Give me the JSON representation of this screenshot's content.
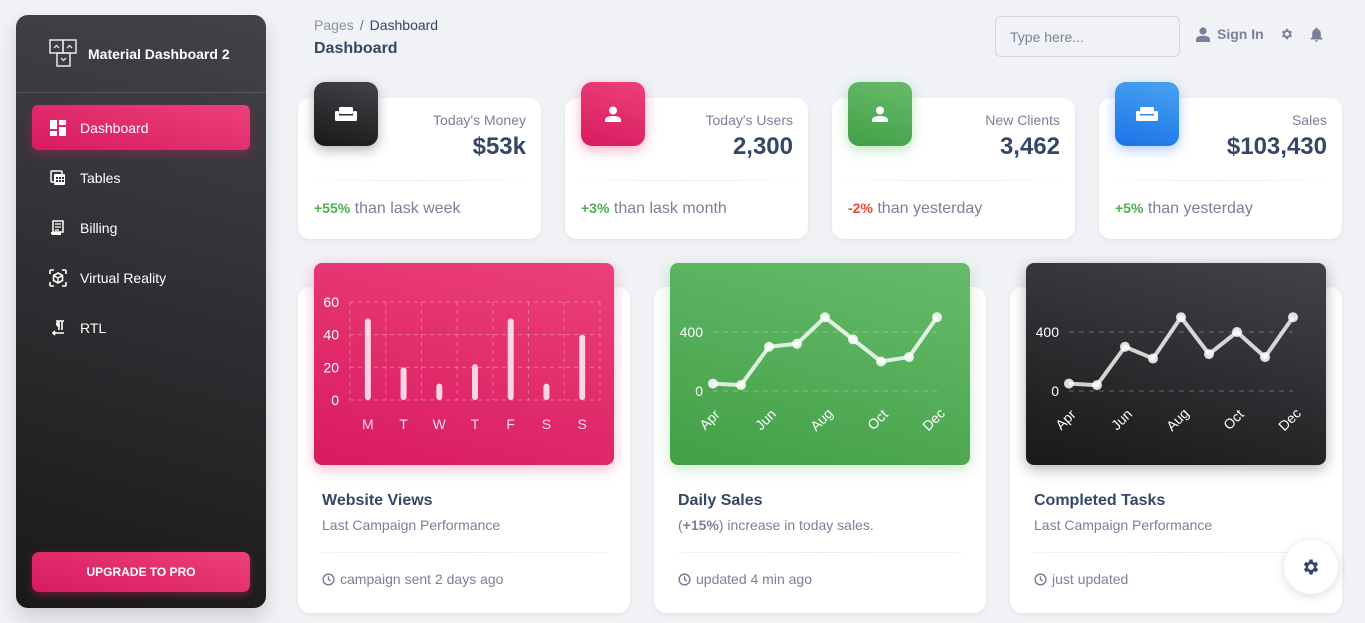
{
  "sidebar": {
    "brand": "Material Dashboard 2",
    "items": [
      {
        "label": "Dashboard",
        "icon": "dashboard-icon",
        "active": true
      },
      {
        "label": "Tables",
        "icon": "table-icon",
        "active": false
      },
      {
        "label": "Billing",
        "icon": "receipt-icon",
        "active": false
      },
      {
        "label": "Virtual Reality",
        "icon": "view-in-ar-icon",
        "active": false
      },
      {
        "label": "RTL",
        "icon": "format-textdirection-r-to-l-icon",
        "active": false
      }
    ],
    "upgrade_label": "UPGRADE TO PRO"
  },
  "header": {
    "breadcrumb_root": "Pages",
    "breadcrumb_sep": "/",
    "breadcrumb_current": "Dashboard",
    "title": "Dashboard",
    "search_placeholder": "Type here...",
    "sign_in": "Sign In"
  },
  "stats": [
    {
      "label": "Today's Money",
      "value": "$53k",
      "change": "+55%",
      "change_type": "positive",
      "suffix": " than lask week",
      "icon": "weekend-icon",
      "color": "dark"
    },
    {
      "label": "Today's Users",
      "value": "2,300",
      "change": "+3%",
      "change_type": "positive",
      "suffix": " than lask month",
      "icon": "person-icon",
      "color": "pink"
    },
    {
      "label": "New Clients",
      "value": "3,462",
      "change": "-2%",
      "change_type": "negative",
      "suffix": " than yesterday",
      "icon": "person-icon",
      "color": "green"
    },
    {
      "label": "Sales",
      "value": "$103,430",
      "change": "+5%",
      "change_type": "positive",
      "suffix": " than yesterday",
      "icon": "weekend-icon",
      "color": "blue"
    }
  ],
  "charts": [
    {
      "title": "Website Views",
      "subtitle": "Last Campaign Performance",
      "subtitle_bold": "",
      "footer": "campaign sent 2 days ago"
    },
    {
      "title": "Daily Sales",
      "subtitle_prefix": "(",
      "subtitle_bold": "+15%",
      "subtitle": ") increase in today sales.",
      "footer": "updated 4 min ago"
    },
    {
      "title": "Completed Tasks",
      "subtitle": "Last Campaign Performance",
      "subtitle_bold": "",
      "footer": "just updated"
    }
  ],
  "chart_data": [
    {
      "type": "bar",
      "title": "Website Views",
      "categories": [
        "M",
        "T",
        "W",
        "T",
        "F",
        "S",
        "S"
      ],
      "values": [
        50,
        20,
        10,
        22,
        50,
        10,
        40
      ],
      "yticks": [
        0,
        20,
        40,
        60
      ],
      "ylim": [
        0,
        60
      ],
      "grid": true,
      "xlabel": "",
      "ylabel": ""
    },
    {
      "type": "line",
      "title": "Daily Sales",
      "categories": [
        "Apr",
        "May",
        "Jun",
        "Jul",
        "Aug",
        "Sep",
        "Oct",
        "Nov",
        "Dec"
      ],
      "xtick_labels": [
        "Apr",
        "",
        "Jun",
        "",
        "Aug",
        "",
        "Oct",
        "",
        "Dec"
      ],
      "values": [
        50,
        40,
        300,
        320,
        500,
        350,
        200,
        230,
        500
      ],
      "yticks": [
        0,
        400
      ],
      "ylim": [
        0,
        500
      ],
      "grid": true,
      "xlabel": "",
      "ylabel": ""
    },
    {
      "type": "line",
      "title": "Completed Tasks",
      "categories": [
        "Apr",
        "May",
        "Jun",
        "Jul",
        "Aug",
        "Sep",
        "Oct",
        "Nov",
        "Dec"
      ],
      "xtick_labels": [
        "Apr",
        "",
        "Jun",
        "",
        "Aug",
        "",
        "Oct",
        "",
        "Dec"
      ],
      "values": [
        50,
        40,
        300,
        220,
        500,
        250,
        400,
        230,
        500
      ],
      "yticks": [
        0,
        400
      ],
      "ylim": [
        0,
        500
      ],
      "grid": true,
      "xlabel": "",
      "ylabel": ""
    }
  ],
  "colors": {
    "primary": "#e91e63",
    "success": "#4caf50",
    "info": "#1a73e8",
    "dark": "#344767",
    "danger": "#f44335"
  }
}
